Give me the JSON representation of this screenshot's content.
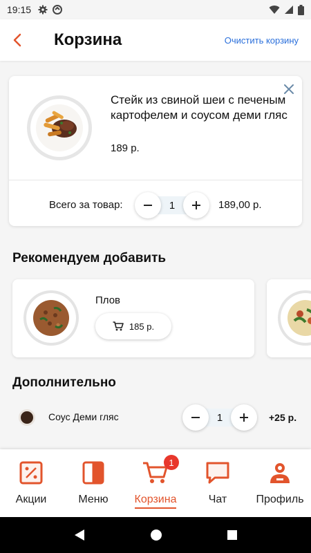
{
  "status_bar": {
    "time": "19:15"
  },
  "header": {
    "title": "Корзина",
    "clear_label": "Очистить корзину"
  },
  "cart_item": {
    "name": "Стейк из свиной шеи с печеным картофелем и соусом деми гляс",
    "price": "189 р.",
    "total_label": "Всего за товар:",
    "quantity": "1",
    "total_value": "189,00 р."
  },
  "recommend": {
    "title": "Рекомендуем добавить",
    "items": [
      {
        "name": "Плов",
        "price": "185 р."
      }
    ]
  },
  "extras": {
    "title": "Дополнительно",
    "items": [
      {
        "name": "Соус Деми гляс",
        "quantity": "1",
        "price": "+25 р."
      }
    ]
  },
  "nav": {
    "items": [
      {
        "label": "Акции",
        "icon": "discount-icon"
      },
      {
        "label": "Меню",
        "icon": "menu-book-icon"
      },
      {
        "label": "Корзина",
        "icon": "cart-icon",
        "badge": "1",
        "active": true
      },
      {
        "label": "Чат",
        "icon": "chat-icon"
      },
      {
        "label": "Профиль",
        "icon": "profile-icon"
      }
    ]
  },
  "colors": {
    "accent": "#e2542c",
    "link": "#2a6fdb",
    "badge": "#e8372c"
  }
}
